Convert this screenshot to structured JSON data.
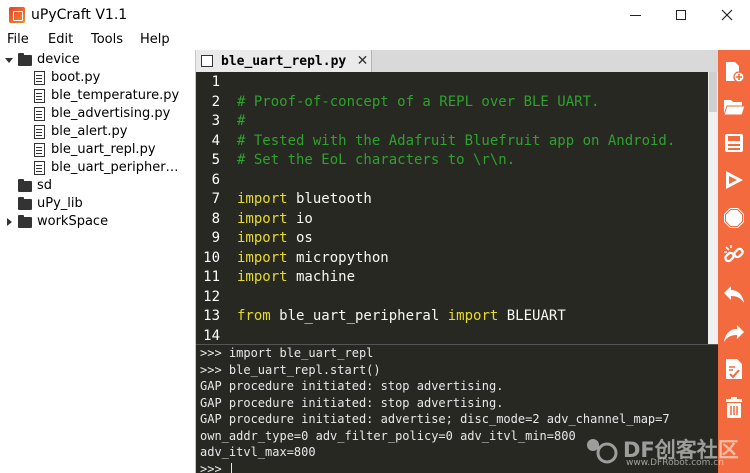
{
  "window": {
    "title": "uPyCraft V1.1"
  },
  "menu": {
    "items": [
      "File",
      "Edit",
      "Tools",
      "Help"
    ]
  },
  "tree": {
    "device": "device",
    "files": [
      "boot.py",
      "ble_temperature.py",
      "ble_advertising.py",
      "ble_alert.py",
      "ble_uart_repl.py",
      "ble_uart_peripher…"
    ],
    "sd": "sd",
    "upy_lib": "uPy_lib",
    "workspace": "workSpace"
  },
  "editor": {
    "tab_label": "ble_uart_repl.py",
    "lines": [
      {
        "n": "1",
        "tokens": []
      },
      {
        "n": "2",
        "tokens": [
          {
            "t": "comment",
            "v": "# Proof-of-concept of a REPL over BLE UART."
          }
        ]
      },
      {
        "n": "3",
        "tokens": [
          {
            "t": "comment",
            "v": "#"
          }
        ]
      },
      {
        "n": "4",
        "tokens": [
          {
            "t": "comment",
            "v": "# Tested with the Adafruit Bluefruit app on Android."
          }
        ]
      },
      {
        "n": "5",
        "tokens": [
          {
            "t": "comment",
            "v": "# Set the EoL characters to \\r\\n."
          }
        ]
      },
      {
        "n": "6",
        "tokens": []
      },
      {
        "n": "7",
        "tokens": [
          {
            "t": "keyword",
            "v": "import"
          },
          {
            "t": "plain",
            "v": " bluetooth"
          }
        ]
      },
      {
        "n": "8",
        "tokens": [
          {
            "t": "keyword",
            "v": "import"
          },
          {
            "t": "plain",
            "v": " io"
          }
        ]
      },
      {
        "n": "9",
        "tokens": [
          {
            "t": "keyword",
            "v": "import"
          },
          {
            "t": "plain",
            "v": " os"
          }
        ]
      },
      {
        "n": "10",
        "tokens": [
          {
            "t": "keyword",
            "v": "import"
          },
          {
            "t": "plain",
            "v": " micropython"
          }
        ]
      },
      {
        "n": "11",
        "tokens": [
          {
            "t": "keyword",
            "v": "import"
          },
          {
            "t": "plain",
            "v": " machine"
          }
        ]
      },
      {
        "n": "12",
        "tokens": []
      },
      {
        "n": "13",
        "tokens": [
          {
            "t": "keyword",
            "v": "from"
          },
          {
            "t": "plain",
            "v": " ble_uart_peripheral "
          },
          {
            "t": "keyword",
            "v": "import"
          },
          {
            "t": "plain",
            "v": " BLEUART"
          }
        ]
      },
      {
        "n": "14",
        "tokens": []
      }
    ]
  },
  "terminal": {
    "lines": [
      ">>> import ble_uart_repl",
      ">>> ble_uart_repl.start()",
      "GAP procedure initiated: stop advertising.",
      "GAP procedure initiated: stop advertising.",
      "GAP procedure initiated: advertise; disc_mode=2 adv_channel_map=7",
      "own_addr_type=0 adv_filter_policy=0 adv_itvl_min=800",
      "adv_itvl_max=800",
      ">>> "
    ]
  },
  "toolbar": {
    "buttons": [
      "new-file-icon",
      "open-folder-icon",
      "save-icon",
      "download-run-icon",
      "stop-icon",
      "connect-icon",
      "undo-icon",
      "redo-icon",
      "syntax-check-icon",
      "clear-icon"
    ]
  },
  "watermark": {
    "brand": "DF创客社区",
    "url": "www.DFRobot.com.cn"
  },
  "colors": {
    "editor_bg": "#272822",
    "comment": "#2ea22e",
    "keyword": "#e6db2a",
    "toolbar": "#f26a3d"
  }
}
